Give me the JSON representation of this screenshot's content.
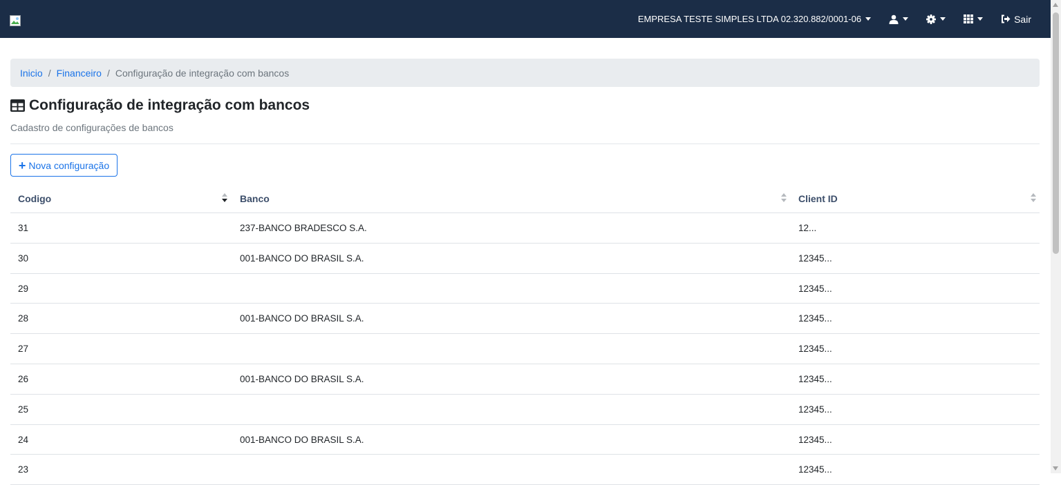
{
  "navbar": {
    "company": "EMPRESA TESTE SIMPLES LTDA 02.320.882/0001-06",
    "user_icon": "user-icon",
    "settings_icon": "gear-icon",
    "apps_icon": "grid-icon",
    "logout_label": "Sair"
  },
  "breadcrumb": {
    "items": [
      "Inicio",
      "Financeiro"
    ],
    "current": "Configuração de integração com bancos"
  },
  "page": {
    "title": "Configuração de integração com bancos",
    "subtitle": "Cadastro de configurações de bancos",
    "new_button": "Nova configuração"
  },
  "table": {
    "columns": [
      "Codigo",
      "Banco",
      "Client ID"
    ],
    "rows": [
      {
        "codigo": "31",
        "banco": "237-BANCO BRADESCO S.A.",
        "client_id": "12..."
      },
      {
        "codigo": "30",
        "banco": "001-BANCO DO BRASIL S.A.",
        "client_id": "12345..."
      },
      {
        "codigo": "29",
        "banco": "",
        "client_id": "12345..."
      },
      {
        "codigo": "28",
        "banco": "001-BANCO DO BRASIL S.A.",
        "client_id": "12345..."
      },
      {
        "codigo": "27",
        "banco": "",
        "client_id": "12345..."
      },
      {
        "codigo": "26",
        "banco": "001-BANCO DO BRASIL S.A.",
        "client_id": "12345..."
      },
      {
        "codigo": "25",
        "banco": "",
        "client_id": "12345..."
      },
      {
        "codigo": "24",
        "banco": "001-BANCO DO BRASIL S.A.",
        "client_id": "12345..."
      },
      {
        "codigo": "23",
        "banco": "",
        "client_id": "12345..."
      }
    ]
  },
  "colors": {
    "navbar_bg": "#1b2d47",
    "link": "#1a73e8",
    "breadcrumb_bg": "#e9ecef"
  }
}
